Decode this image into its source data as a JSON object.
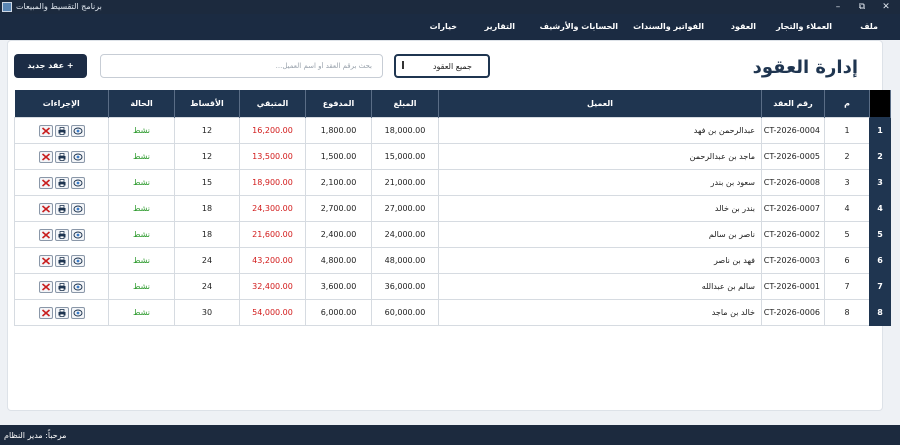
{
  "window": {
    "title": "برنامج التقسيط والمبيعات",
    "minimize": "–",
    "maximize": "⧉",
    "close": "✕"
  },
  "menu": [
    "ملف",
    "العملاء والتجار",
    "العقود",
    "الفواتير والسندات",
    "الحسابات والأرشيف",
    "التقارير",
    "خيارات"
  ],
  "page": {
    "title": "إدارة العقود",
    "filter_value": "جميع العقود",
    "search_placeholder": "بحث برقم العقد أو اسم العميل...",
    "new_button": "عقد جديد +"
  },
  "table": {
    "headers": {
      "index": "م",
      "contract_no": "رقم العقد",
      "client": "العميل",
      "amount": "المبلغ",
      "paid": "المدفوع",
      "remaining": "المتبقي",
      "installments": "الأقساط",
      "status": "الحالة",
      "actions": "الإجراءات"
    },
    "rows": [
      {
        "row": "1",
        "index": "1",
        "contract_no": "CT-2026-0004",
        "client": "عبدالرحمن بن فهد",
        "amount": "18,000.00",
        "paid": "1,800.00",
        "remaining": "16,200.00",
        "installments": "12",
        "status": "نشط"
      },
      {
        "row": "2",
        "index": "2",
        "contract_no": "CT-2026-0005",
        "client": "ماجد بن عبدالرحمن",
        "amount": "15,000.00",
        "paid": "1,500.00",
        "remaining": "13,500.00",
        "installments": "12",
        "status": "نشط"
      },
      {
        "row": "3",
        "index": "3",
        "contract_no": "CT-2026-0008",
        "client": "سعود بن بندر",
        "amount": "21,000.00",
        "paid": "2,100.00",
        "remaining": "18,900.00",
        "installments": "15",
        "status": "نشط"
      },
      {
        "row": "4",
        "index": "4",
        "contract_no": "CT-2026-0007",
        "client": "بندر بن خالد",
        "amount": "27,000.00",
        "paid": "2,700.00",
        "remaining": "24,300.00",
        "installments": "18",
        "status": "نشط"
      },
      {
        "row": "5",
        "index": "5",
        "contract_no": "CT-2026-0002",
        "client": "ناصر بن سالم",
        "amount": "24,000.00",
        "paid": "2,400.00",
        "remaining": "21,600.00",
        "installments": "18",
        "status": "نشط"
      },
      {
        "row": "6",
        "index": "6",
        "contract_no": "CT-2026-0003",
        "client": "فهد بن ناصر",
        "amount": "48,000.00",
        "paid": "4,800.00",
        "remaining": "43,200.00",
        "installments": "24",
        "status": "نشط"
      },
      {
        "row": "7",
        "index": "7",
        "contract_no": "CT-2026-0001",
        "client": "سالم بن عبدالله",
        "amount": "36,000.00",
        "paid": "3,600.00",
        "remaining": "32,400.00",
        "installments": "24",
        "status": "نشط"
      },
      {
        "row": "8",
        "index": "8",
        "contract_no": "CT-2026-0006",
        "client": "خالد بن ماجد",
        "amount": "60,000.00",
        "paid": "6,000.00",
        "remaining": "54,000.00",
        "installments": "30",
        "status": "نشط"
      }
    ]
  },
  "statusbar": {
    "text": "مرحباً: مدير النظام"
  },
  "colors": {
    "navy": "#1f3550",
    "remaining": "#d21b1b",
    "active": "#2c9a2c"
  }
}
